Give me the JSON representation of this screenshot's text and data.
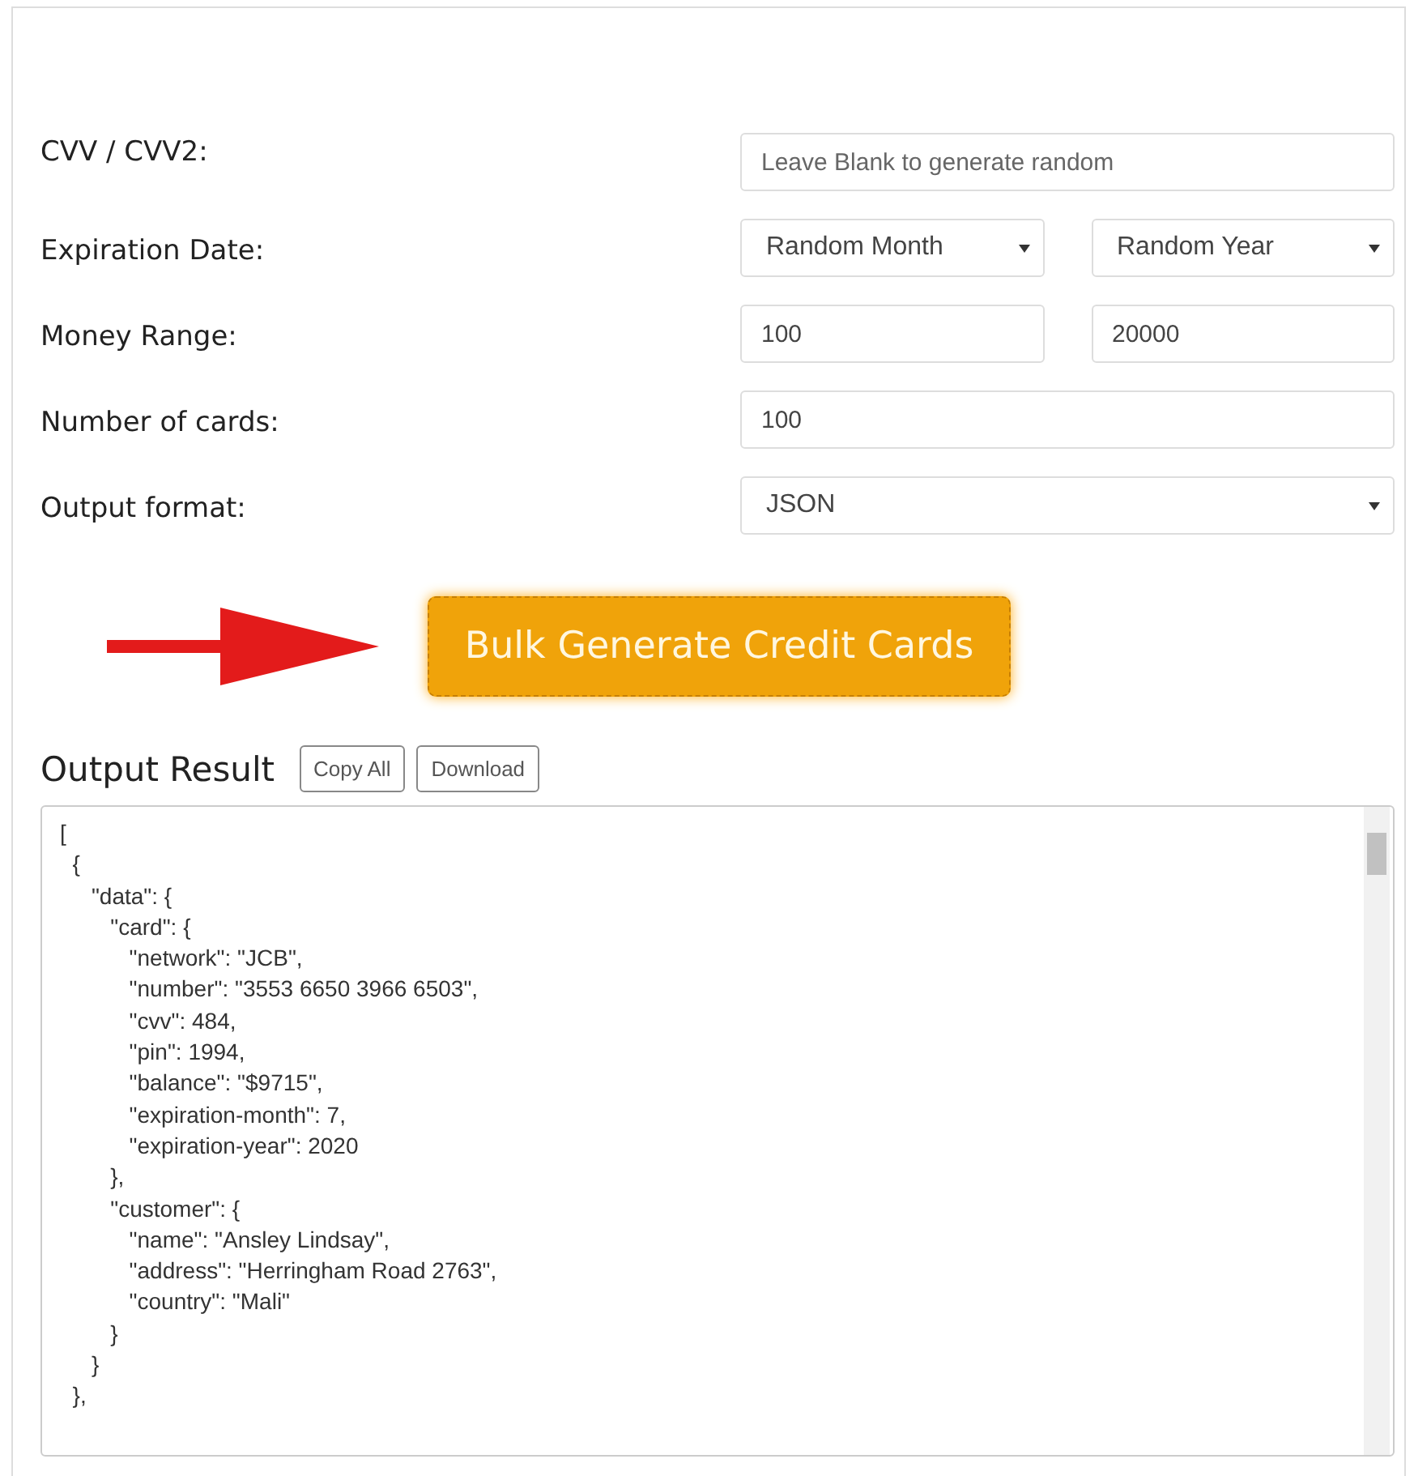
{
  "form": {
    "rows": [
      {
        "label": "CVV / CVV2:",
        "fields": [
          {
            "kind": "input",
            "placeholder": "Leave Blank to generate random"
          }
        ]
      },
      {
        "label": "Expiration Date:",
        "fields": [
          {
            "kind": "select",
            "value": "Random Month"
          },
          {
            "kind": "select",
            "value": "Random Year"
          }
        ]
      },
      {
        "label": "Money Range:",
        "fields": [
          {
            "kind": "input",
            "value": "100"
          },
          {
            "kind": "input",
            "value": "20000"
          }
        ]
      },
      {
        "label": "Number of cards:",
        "fields": [
          {
            "kind": "input",
            "value": "100"
          }
        ]
      },
      {
        "label": "Output format:",
        "fields": [
          {
            "kind": "select",
            "value": "JSON"
          }
        ]
      }
    ]
  },
  "generate_button": "Bulk Generate Credit Cards",
  "output": {
    "title": "Output Result",
    "buttons": [
      "Copy All",
      "Download"
    ],
    "lines": [
      "[",
      "  {",
      "     \"data\": {",
      "        \"card\": {",
      "           \"network\": \"JCB\",",
      "           \"number\": \"3553 6650 3966 6503\",",
      "           \"cvv\": 484,",
      "           \"pin\": 1994,",
      "           \"balance\": \"$9715\",",
      "           \"expiration-month\": 7,",
      "           \"expiration-year\": 2020",
      "        },",
      "        \"customer\": {",
      "           \"name\": \"Ansley Lindsay\",",
      "           \"address\": \"Herringham Road 2763\",",
      "           \"country\": \"Mali\"",
      "        }",
      "     }",
      "  },"
    ]
  }
}
